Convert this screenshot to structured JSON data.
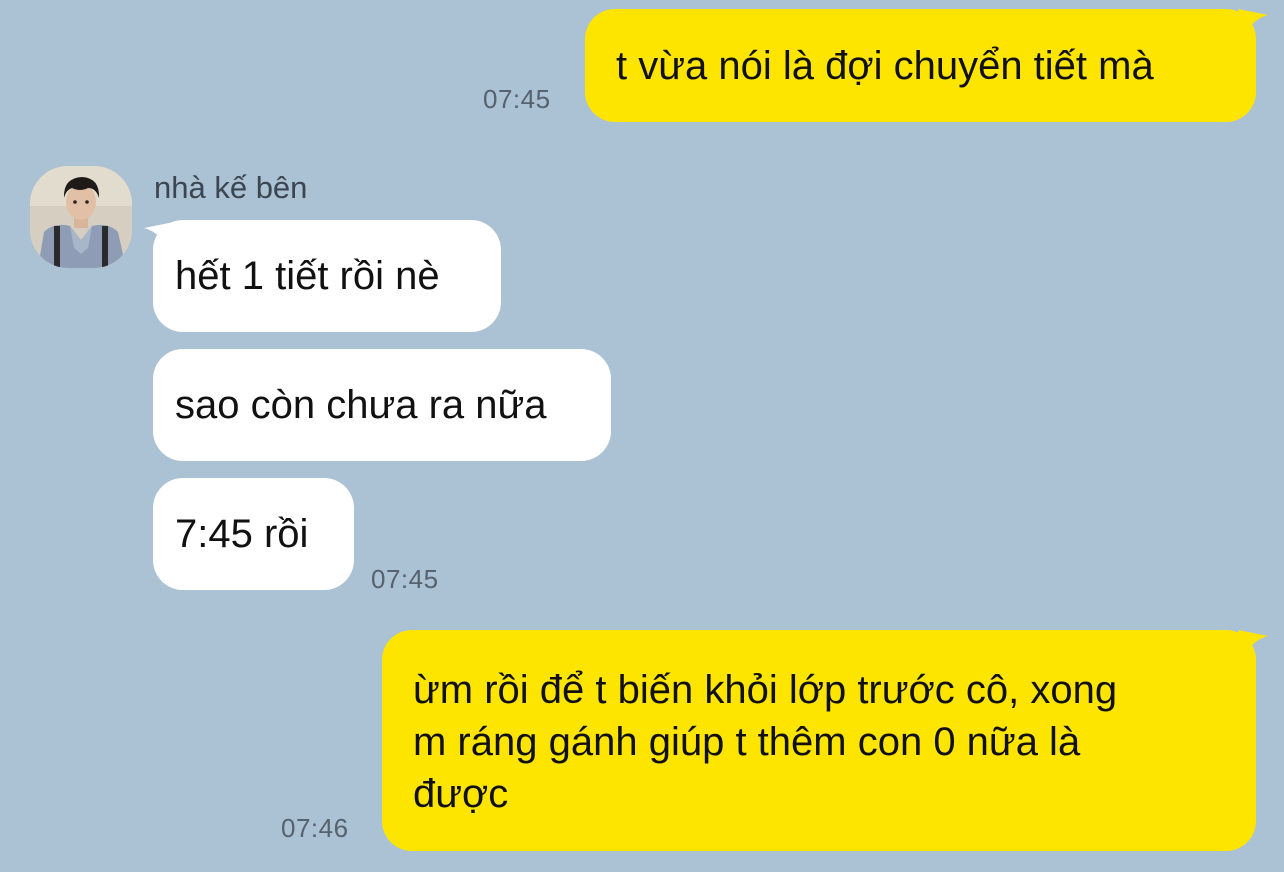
{
  "colors": {
    "background": "#abc1d4",
    "my_bubble": "#fee500",
    "their_bubble": "#ffffff"
  },
  "contact": {
    "name": "nhà kế bên",
    "avatar_icon": "profile-photo-icon"
  },
  "messages": [
    {
      "from": "me",
      "text": "t vừa nói là đợi chuyển tiết mà",
      "time": "07:45"
    },
    {
      "from": "them",
      "text": "hết 1 tiết rồi nè"
    },
    {
      "from": "them",
      "text": "sao còn chưa ra nữa"
    },
    {
      "from": "them",
      "text": "7:45 rồi",
      "time": "07:45"
    },
    {
      "from": "me",
      "lines": [
        "ừm rồi để t biến khỏi lớp trước cô, xong",
        "m ráng gánh giúp t thêm con 0 nữa là",
        "được"
      ],
      "time": "07:46"
    }
  ]
}
